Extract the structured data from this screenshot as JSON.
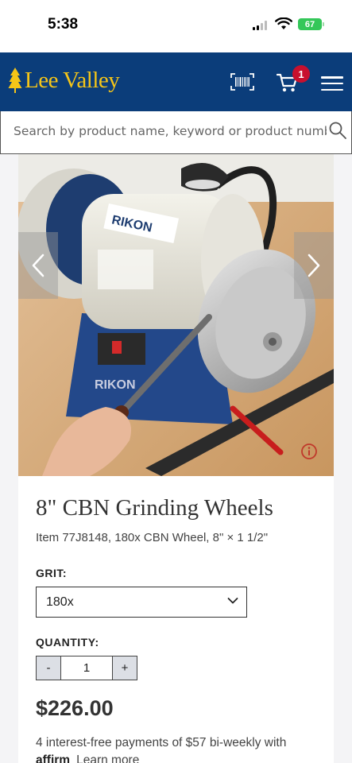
{
  "status_bar": {
    "time": "5:38",
    "battery": "67"
  },
  "header": {
    "logo_text": "Lee Valley",
    "cart_count": "1",
    "icons": [
      "tree-logo-icon",
      "barcode-icon",
      "cart-icon",
      "menu-icon"
    ],
    "background_color": "#0b3d7a",
    "logo_color": "#f5c518",
    "badge_color": "#c8102e"
  },
  "search": {
    "placeholder": "Search by product name, keyword or product number"
  },
  "product": {
    "image_brand_text": "RIKON",
    "title": "8\" CBN Grinding Wheels",
    "item_line": "Item 77J8148, 180x CBN Wheel, 8\" × 1 1/2\"",
    "grit_label": "GRIT:",
    "grit_value": "180x",
    "quantity_label": "QUANTITY:",
    "qty_minus": "-",
    "qty_value": "1",
    "qty_plus": "+",
    "price": "$226.00",
    "installments": "4 interest-free payments of $57 bi-weekly with",
    "affirm_logo": "affirm",
    "learn_more": "Learn more"
  }
}
